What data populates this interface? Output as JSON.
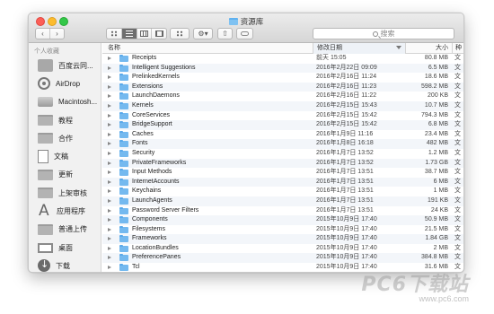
{
  "window": {
    "title": "资源库"
  },
  "toolbar": {
    "back": "‹",
    "forward": "›",
    "search_placeholder": "搜索"
  },
  "sidebar": {
    "header": "个人收藏",
    "items": [
      {
        "label": "百度云同...",
        "icon": "app-icon"
      },
      {
        "label": "AirDrop",
        "icon": "airdrop-icon"
      },
      {
        "label": "Macintosh...",
        "icon": "harddisk-icon"
      },
      {
        "label": "教程",
        "icon": "folder-icon"
      },
      {
        "label": "合作",
        "icon": "folder-icon"
      },
      {
        "label": "文稿",
        "icon": "document-icon"
      },
      {
        "label": "更新",
        "icon": "folder-icon"
      },
      {
        "label": "上架审核",
        "icon": "folder-icon"
      },
      {
        "label": "应用程序",
        "icon": "applications-icon"
      },
      {
        "label": "普通上传",
        "icon": "folder-icon"
      },
      {
        "label": "桌面",
        "icon": "desktop-icon"
      },
      {
        "label": "下载",
        "icon": "download-icon"
      }
    ]
  },
  "columns": {
    "name": "名称",
    "date": "修改日期",
    "size": "大小",
    "kind": "种"
  },
  "files": [
    {
      "name": "Receipts",
      "date": "前天 15:05",
      "size": "80.8 MB",
      "kind": "文"
    },
    {
      "name": "Intelligent Suggestions",
      "date": "2016年2月22日 09:09",
      "size": "6.5 MB",
      "kind": "文"
    },
    {
      "name": "PrelinkedKernels",
      "date": "2016年2月16日 11:24",
      "size": "18.6 MB",
      "kind": "文"
    },
    {
      "name": "Extensions",
      "date": "2016年2月16日 11:23",
      "size": "598.2 MB",
      "kind": "文"
    },
    {
      "name": "LaunchDaemons",
      "date": "2016年2月16日 11:22",
      "size": "200 KB",
      "kind": "文"
    },
    {
      "name": "Kernels",
      "date": "2016年2月15日 15:43",
      "size": "10.7 MB",
      "kind": "文"
    },
    {
      "name": "CoreServices",
      "date": "2016年2月15日 15:42",
      "size": "794.3 MB",
      "kind": "文"
    },
    {
      "name": "BridgeSupport",
      "date": "2016年2月15日 15:42",
      "size": "6.8 MB",
      "kind": "文"
    },
    {
      "name": "Caches",
      "date": "2016年1月9日 11:16",
      "size": "23.4 MB",
      "kind": "文"
    },
    {
      "name": "Fonts",
      "date": "2016年1月8日 16:18",
      "size": "482 MB",
      "kind": "文"
    },
    {
      "name": "Security",
      "date": "2016年1月7日 13:52",
      "size": "1.2 MB",
      "kind": "文"
    },
    {
      "name": "PrivateFrameworks",
      "date": "2016年1月7日 13:52",
      "size": "1.73 GB",
      "kind": "文"
    },
    {
      "name": "Input Methods",
      "date": "2016年1月7日 13:51",
      "size": "38.7 MB",
      "kind": "文"
    },
    {
      "name": "InternetAccounts",
      "date": "2016年1月7日 13:51",
      "size": "6 MB",
      "kind": "文"
    },
    {
      "name": "Keychains",
      "date": "2016年1月7日 13:51",
      "size": "1 MB",
      "kind": "文"
    },
    {
      "name": "LaunchAgents",
      "date": "2016年1月7日 13:51",
      "size": "191 KB",
      "kind": "文"
    },
    {
      "name": "Password Server Filters",
      "date": "2016年1月7日 13:51",
      "size": "24 KB",
      "kind": "文"
    },
    {
      "name": "Components",
      "date": "2015年10月9日 17:40",
      "size": "50.9 MB",
      "kind": "文"
    },
    {
      "name": "Filesystems",
      "date": "2015年10月9日 17:40",
      "size": "21.5 MB",
      "kind": "文"
    },
    {
      "name": "Frameworks",
      "date": "2015年10月9日 17:40",
      "size": "1.84 GB",
      "kind": "文"
    },
    {
      "name": "LocationBundles",
      "date": "2015年10月9日 17:40",
      "size": "2 MB",
      "kind": "文"
    },
    {
      "name": "PreferencePanes",
      "date": "2015年10月9日 17:40",
      "size": "384.8 MB",
      "kind": "文"
    },
    {
      "name": "Tcl",
      "date": "2015年10月9日 17:40",
      "size": "31.6 MB",
      "kind": "文"
    }
  ],
  "watermark": {
    "logo": "PC6下载站",
    "url": "www.pc6.com"
  }
}
